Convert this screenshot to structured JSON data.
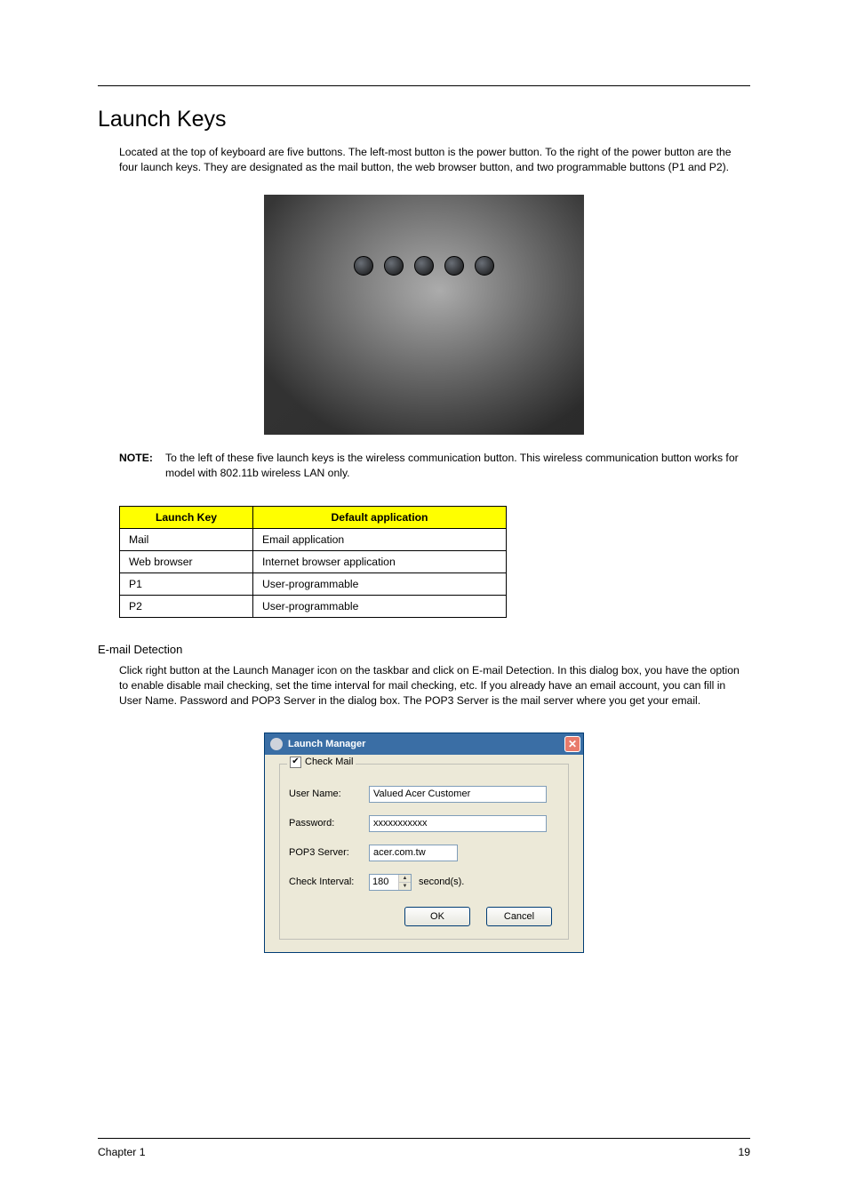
{
  "section_title": "Launch Keys",
  "intro_paragraph": "Located at the top of keyboard are five buttons. The left-most button is the power button. To the right of the power button are the four launch keys. They are designated as the mail button, the web browser button, and two programmable buttons (P1 and P2).",
  "note": {
    "label": "NOTE:",
    "text": "To the left of these five launch keys is the wireless communication button. This wireless communication button works for model with 802.11b wireless LAN only."
  },
  "table": {
    "headers": [
      "Launch Key",
      "Default application"
    ],
    "rows": [
      [
        "Mail",
        "Email application"
      ],
      [
        "Web browser",
        "Internet browser application"
      ],
      [
        "P1",
        "User-programmable"
      ],
      [
        "P2",
        "User-programmable"
      ]
    ]
  },
  "subheading": "E-mail Detection",
  "subparagraph": "Click right button at the Launch Manager icon on the taskbar and click on E-mail Detection. In this dialog box, you have the option to enable disable mail checking, set the time interval for mail checking, etc. If you already have an email account, you can fill in User Name. Password and POP3 Server in the dialog box. The POP3 Server is the mail server where you get your email.",
  "dialog": {
    "title": "Launch Manager",
    "checkbox_checked": true,
    "checkbox_label": "Check Mail",
    "user_name_label": "User Name:",
    "user_name_value": "Valued Acer Customer",
    "password_label": "Password:",
    "password_value": "xxxxxxxxxxx",
    "pop3_label": "POP3 Server:",
    "pop3_value": "acer.com.tw",
    "interval_label": "Check Interval:",
    "interval_value": "180",
    "interval_suffix": "second(s).",
    "ok": "OK",
    "cancel": "Cancel"
  },
  "footer": {
    "left": "Chapter 1",
    "right": "19"
  }
}
